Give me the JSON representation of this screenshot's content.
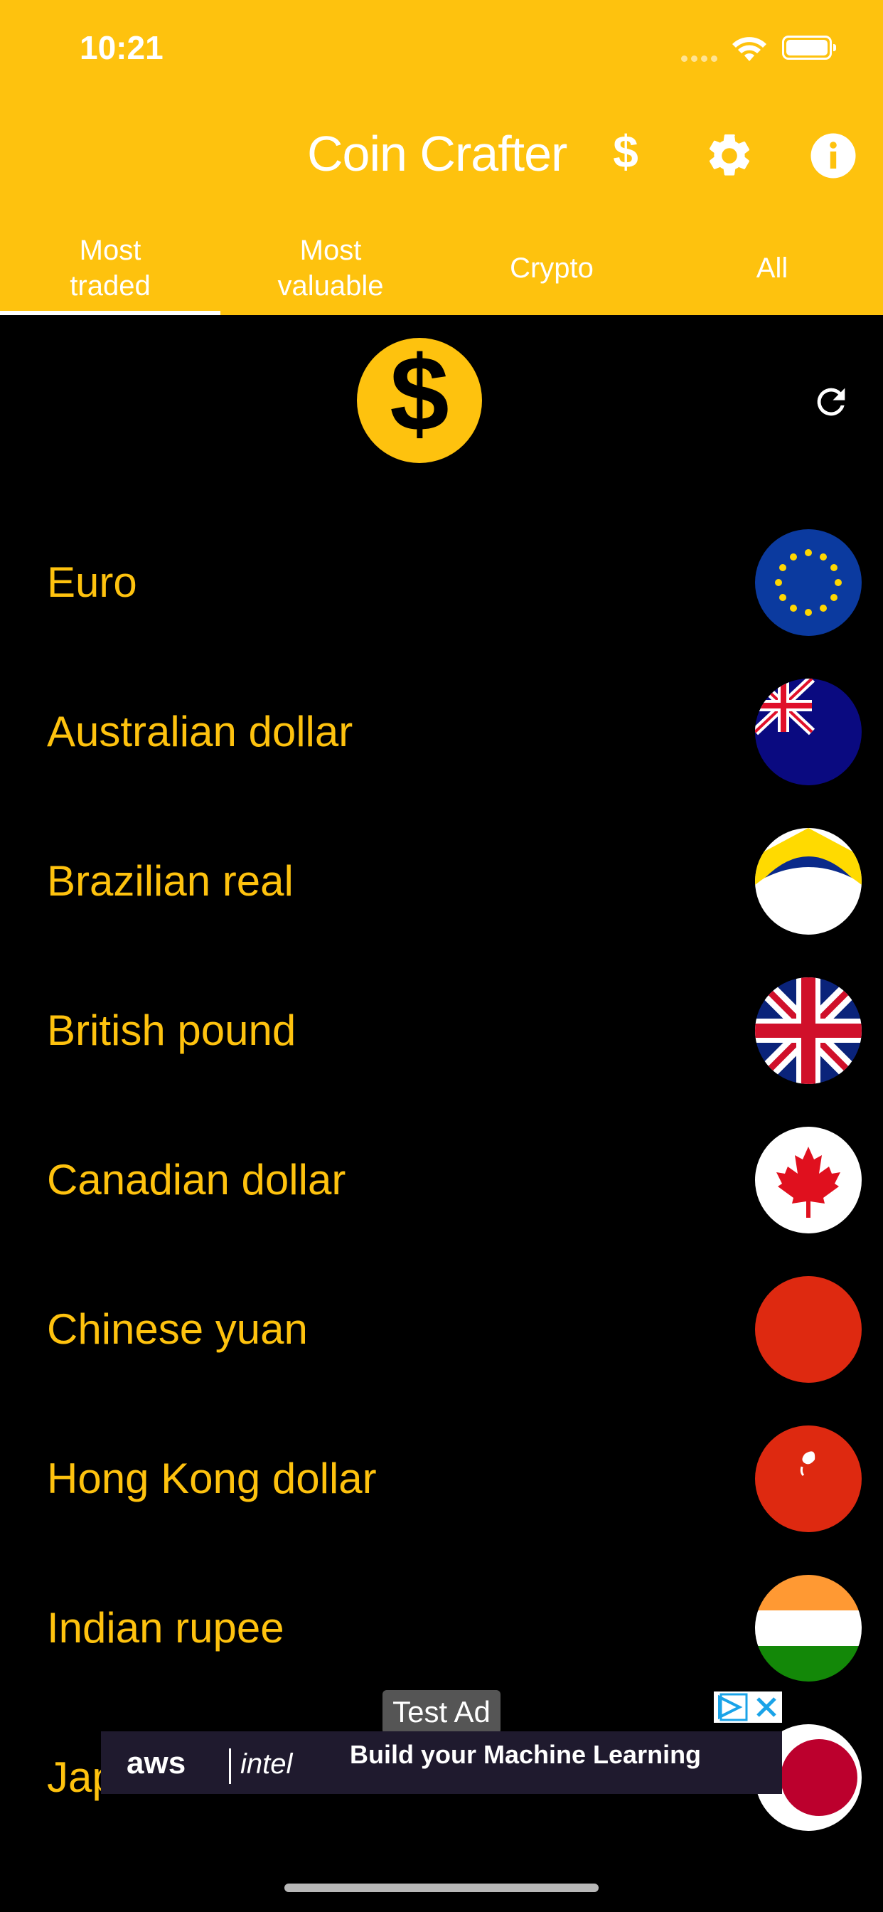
{
  "status_bar": {
    "time": "10:21"
  },
  "header": {
    "title": "Coin Crafter",
    "currency_symbol": "$",
    "settings_icon": "gear-icon",
    "info_icon": "info-icon"
  },
  "tabs": [
    {
      "label": "Most\ntraded",
      "active": true
    },
    {
      "label": "Most\nvaluable",
      "active": false
    },
    {
      "label": "Crypto",
      "active": false
    },
    {
      "label": "All",
      "active": false
    }
  ],
  "base_currency": {
    "symbol": "$",
    "icon": "dollar-coin-icon"
  },
  "refresh_icon": "refresh-icon",
  "currencies": [
    {
      "name": "Euro",
      "flag": "eu-flag-icon"
    },
    {
      "name": "Australian dollar",
      "flag": "australia-flag-icon"
    },
    {
      "name": "Brazilian real",
      "flag": "brazil-flag-icon"
    },
    {
      "name": "British pound",
      "flag": "uk-flag-icon"
    },
    {
      "name": "Canadian dollar",
      "flag": "canada-flag-icon"
    },
    {
      "name": "Chinese yuan",
      "flag": "china-flag-icon"
    },
    {
      "name": "Hong Kong dollar",
      "flag": "hong-kong-flag-icon"
    },
    {
      "name": "Indian rupee",
      "flag": "india-flag-icon"
    },
    {
      "name": "Jap",
      "flag": "japan-flag-icon"
    }
  ],
  "ad": {
    "label": "Test Ad",
    "brand_1": "aws",
    "brand_2": "intel",
    "text": "Build your Machine Learning"
  },
  "colors": {
    "brand_yellow": "#FEC20E",
    "background": "#000000"
  }
}
